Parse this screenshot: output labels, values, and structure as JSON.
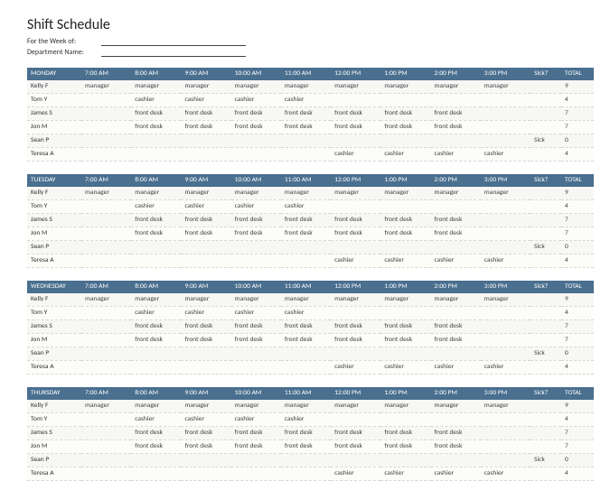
{
  "title": "Shift Schedule",
  "meta": {
    "week_label": "For the Week of:",
    "dept_label": "Department Name:"
  },
  "time_headers": [
    "7:00 AM",
    "8:00 AM",
    "9:00 AM",
    "10:00 AM",
    "11:00 AM",
    "12:00 PM",
    "1:00 PM",
    "2:00 PM",
    "3:00 PM"
  ],
  "sick_header": "Sick?",
  "total_header": "TOTAL",
  "days": [
    {
      "name": "MONDAY",
      "rows": [
        {
          "emp": "Kelly F",
          "shifts": [
            "manager",
            "manager",
            "manager",
            "manager",
            "manager",
            "manager",
            "manager",
            "manager",
            "manager"
          ],
          "sick": "",
          "total": "9"
        },
        {
          "emp": "Tom Y",
          "shifts": [
            "",
            "cashier",
            "cashier",
            "cashier",
            "cashier",
            "",
            "",
            "",
            ""
          ],
          "sick": "",
          "total": "4"
        },
        {
          "emp": "James S",
          "shifts": [
            "",
            "front desk",
            "front desk",
            "front desk",
            "front desk",
            "front desk",
            "front desk",
            "front desk",
            ""
          ],
          "sick": "",
          "total": "7"
        },
        {
          "emp": "Jon M",
          "shifts": [
            "",
            "front desk",
            "front desk",
            "front desk",
            "front desk",
            "front desk",
            "front desk",
            "front desk",
            ""
          ],
          "sick": "",
          "total": "7"
        },
        {
          "emp": "Sean P",
          "shifts": [
            "",
            "",
            "",
            "",
            "",
            "",
            "",
            "",
            ""
          ],
          "sick": "Sick",
          "total": "0"
        },
        {
          "emp": "Teresa A",
          "shifts": [
            "",
            "",
            "",
            "",
            "",
            "cashier",
            "cashier",
            "cashier",
            "cashier"
          ],
          "sick": "",
          "total": "4"
        }
      ]
    },
    {
      "name": "TUESDAY",
      "rows": [
        {
          "emp": "Kelly F",
          "shifts": [
            "manager",
            "manager",
            "manager",
            "manager",
            "manager",
            "manager",
            "manager",
            "manager",
            "manager"
          ],
          "sick": "",
          "total": "9"
        },
        {
          "emp": "Tom Y",
          "shifts": [
            "",
            "cashier",
            "cashier",
            "cashier",
            "cashier",
            "",
            "",
            "",
            ""
          ],
          "sick": "",
          "total": "4"
        },
        {
          "emp": "James S",
          "shifts": [
            "",
            "front desk",
            "front desk",
            "front desk",
            "front desk",
            "front desk",
            "front desk",
            "front desk",
            ""
          ],
          "sick": "",
          "total": "7"
        },
        {
          "emp": "Jon M",
          "shifts": [
            "",
            "front desk",
            "front desk",
            "front desk",
            "front desk",
            "front desk",
            "front desk",
            "front desk",
            ""
          ],
          "sick": "",
          "total": "7"
        },
        {
          "emp": "Sean P",
          "shifts": [
            "",
            "",
            "",
            "",
            "",
            "",
            "",
            "",
            ""
          ],
          "sick": "Sick",
          "total": "0"
        },
        {
          "emp": "Teresa A",
          "shifts": [
            "",
            "",
            "",
            "",
            "",
            "cashier",
            "cashier",
            "cashier",
            "cashier"
          ],
          "sick": "",
          "total": "4"
        }
      ]
    },
    {
      "name": "WEDNESDAY",
      "rows": [
        {
          "emp": "Kelly F",
          "shifts": [
            "manager",
            "manager",
            "manager",
            "manager",
            "manager",
            "manager",
            "manager",
            "manager",
            "manager"
          ],
          "sick": "",
          "total": "9"
        },
        {
          "emp": "Tom Y",
          "shifts": [
            "",
            "cashier",
            "cashier",
            "cashier",
            "cashier",
            "",
            "",
            "",
            ""
          ],
          "sick": "",
          "total": "4"
        },
        {
          "emp": "James S",
          "shifts": [
            "",
            "front desk",
            "front desk",
            "front desk",
            "front desk",
            "front desk",
            "front desk",
            "front desk",
            ""
          ],
          "sick": "",
          "total": "7"
        },
        {
          "emp": "Jon M",
          "shifts": [
            "",
            "front desk",
            "front desk",
            "front desk",
            "front desk",
            "front desk",
            "front desk",
            "front desk",
            ""
          ],
          "sick": "",
          "total": "7"
        },
        {
          "emp": "Sean P",
          "shifts": [
            "",
            "",
            "",
            "",
            "",
            "",
            "",
            "",
            ""
          ],
          "sick": "Sick",
          "total": "0"
        },
        {
          "emp": "Teresa A",
          "shifts": [
            "",
            "",
            "",
            "",
            "",
            "cashier",
            "cashier",
            "cashier",
            "cashier"
          ],
          "sick": "",
          "total": "4"
        }
      ]
    },
    {
      "name": "THURSDAY",
      "rows": [
        {
          "emp": "Kelly F",
          "shifts": [
            "manager",
            "manager",
            "manager",
            "manager",
            "manager",
            "manager",
            "manager",
            "manager",
            "manager"
          ],
          "sick": "",
          "total": "9"
        },
        {
          "emp": "Tom Y",
          "shifts": [
            "",
            "cashier",
            "cashier",
            "cashier",
            "cashier",
            "",
            "",
            "",
            ""
          ],
          "sick": "",
          "total": "4"
        },
        {
          "emp": "James S",
          "shifts": [
            "",
            "front desk",
            "front desk",
            "front desk",
            "front desk",
            "front desk",
            "front desk",
            "front desk",
            ""
          ],
          "sick": "",
          "total": "7"
        },
        {
          "emp": "Jon M",
          "shifts": [
            "",
            "front desk",
            "front desk",
            "front desk",
            "front desk",
            "front desk",
            "front desk",
            "front desk",
            ""
          ],
          "sick": "",
          "total": "7"
        },
        {
          "emp": "Sean P",
          "shifts": [
            "",
            "",
            "",
            "",
            "",
            "",
            "",
            "",
            ""
          ],
          "sick": "Sick",
          "total": "0"
        },
        {
          "emp": "Teresa A",
          "shifts": [
            "",
            "",
            "",
            "",
            "",
            "cashier",
            "cashier",
            "cashier",
            "cashier"
          ],
          "sick": "",
          "total": "4"
        }
      ]
    }
  ]
}
